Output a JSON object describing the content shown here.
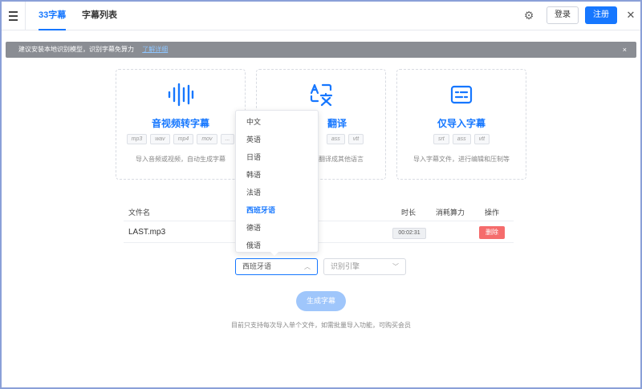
{
  "header": {
    "tabs": [
      {
        "label": "33字幕",
        "active": true
      },
      {
        "label": "字幕列表",
        "active": false
      }
    ],
    "login_label": "登录",
    "register_label": "注册",
    "accent_color": "#1677ff"
  },
  "notice": {
    "text": "建议安装本地识别模型，识别字幕免算力",
    "link_text": "了解详细",
    "close": "×"
  },
  "cards": [
    {
      "title": "音视频转字幕",
      "icon": "audio-wave-icon",
      "tags": [
        "mp3",
        "wav",
        "mp4",
        "mov",
        "..."
      ],
      "desc": "导入音频或视频，自动生成字幕"
    },
    {
      "title": "翻译",
      "icon": "translate-icon",
      "tags": [
        "ass",
        "vtt"
      ],
      "desc": "翻译成其他语言"
    },
    {
      "title": "仅导入字幕",
      "icon": "subtitle-icon",
      "tags": [
        "srt",
        "ass",
        "vtt"
      ],
      "desc": "导入字幕文件，进行编辑和压制等"
    }
  ],
  "table": {
    "headers": {
      "filename": "文件名",
      "duration": "时长",
      "cost": "消耗算力",
      "action": "操作"
    },
    "rows": [
      {
        "filename": "LAST.mp3",
        "duration": "00:02:31",
        "action": "删除"
      }
    ]
  },
  "language_dropdown": {
    "options": [
      "中文",
      "英语",
      "日语",
      "韩语",
      "法语",
      "西班牙语",
      "德语",
      "俄语"
    ],
    "selected": "西班牙语"
  },
  "language_select": {
    "value": "西班牙语"
  },
  "engine_select": {
    "placeholder": "识别引擎"
  },
  "generate_label": "生成字幕",
  "hint": "目前只支持每次导入单个文件，如需批量导入功能，可购买会员"
}
